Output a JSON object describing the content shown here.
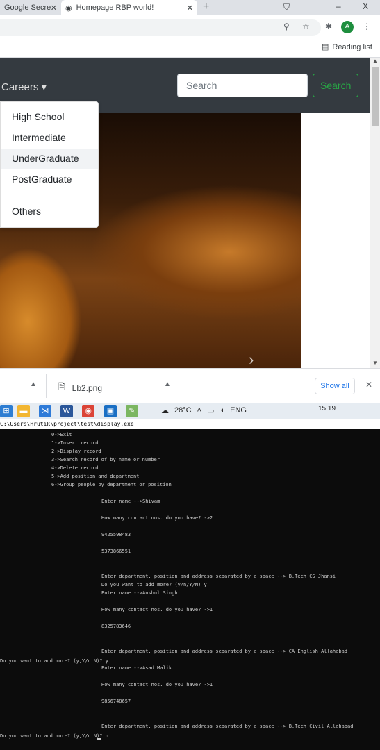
{
  "browser": {
    "tabs": [
      {
        "title": "Google Secre"
      },
      {
        "title": "Homepage RBP world!"
      }
    ],
    "new_tab_symbol": "+",
    "minimize_symbol": "–",
    "close_symbol": "X",
    "profile_initial": "A",
    "reading_list": "Reading list"
  },
  "navbar": {
    "careers_label": "Careers ▾",
    "search_placeholder": "Search",
    "search_button": "Search"
  },
  "dropdown": {
    "items": [
      {
        "label": "High School"
      },
      {
        "label": "Intermediate"
      },
      {
        "label": "UnderGraduate"
      },
      {
        "label": "PostGraduate"
      },
      {
        "label": "Others"
      }
    ]
  },
  "carousel": {
    "next_symbol": "›"
  },
  "download_bar": {
    "file_name": "Lb2.png",
    "show_all": "Show all"
  },
  "taskbar": {
    "temperature": "28°C",
    "language": "ENG",
    "time": "15:19"
  },
  "console": {
    "title": "C:\\Users\\Hrutik\\project\\test\\display.exe",
    "lines": [
      "0->Exit",
      "1->Insert record",
      "2->Display record",
      "3->Search record of by name or number",
      "4->Delete record",
      "5->Add position and department",
      "6->Group people by department or position",
      "Enter name -->Shivam",
      "How many contact nos. do you have? ->2",
      "9425598483",
      "5373866551",
      "Enter department, position and address separated by a space --> B.Tech CS Jhansi",
      "Do you want to add more? (y/n/Y/N) y",
      "Enter name -->Anshul Singh",
      "How many contact nos. do you have? ->1",
      "8325783646",
      "Enter department, position and address separated by a space --> CA English Allahabad",
      "Do you want to add more? (y,Y/n,N)? y",
      "Enter name -->Asad Malik",
      "How many contact nos. do you have? ->1",
      "9856748657",
      "Enter department, position and address separated by a space --> B.Tech Civil Allahabad",
      "Do you want to add more? (y,Y/n,N)? n"
    ]
  }
}
